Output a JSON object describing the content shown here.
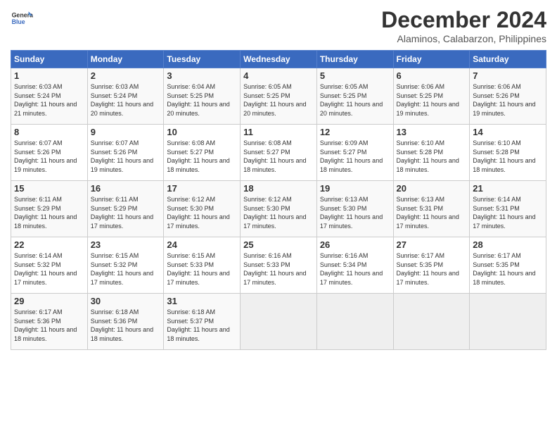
{
  "logo": {
    "line1": "General",
    "line2": "Blue"
  },
  "title": "December 2024",
  "location": "Alaminos, Calabarzon, Philippines",
  "days_of_week": [
    "Sunday",
    "Monday",
    "Tuesday",
    "Wednesday",
    "Thursday",
    "Friday",
    "Saturday"
  ],
  "weeks": [
    [
      {
        "day": "1",
        "sunrise": "Sunrise: 6:03 AM",
        "sunset": "Sunset: 5:24 PM",
        "daylight": "Daylight: 11 hours and 21 minutes."
      },
      {
        "day": "2",
        "sunrise": "Sunrise: 6:03 AM",
        "sunset": "Sunset: 5:24 PM",
        "daylight": "Daylight: 11 hours and 20 minutes."
      },
      {
        "day": "3",
        "sunrise": "Sunrise: 6:04 AM",
        "sunset": "Sunset: 5:25 PM",
        "daylight": "Daylight: 11 hours and 20 minutes."
      },
      {
        "day": "4",
        "sunrise": "Sunrise: 6:05 AM",
        "sunset": "Sunset: 5:25 PM",
        "daylight": "Daylight: 11 hours and 20 minutes."
      },
      {
        "day": "5",
        "sunrise": "Sunrise: 6:05 AM",
        "sunset": "Sunset: 5:25 PM",
        "daylight": "Daylight: 11 hours and 20 minutes."
      },
      {
        "day": "6",
        "sunrise": "Sunrise: 6:06 AM",
        "sunset": "Sunset: 5:25 PM",
        "daylight": "Daylight: 11 hours and 19 minutes."
      },
      {
        "day": "7",
        "sunrise": "Sunrise: 6:06 AM",
        "sunset": "Sunset: 5:26 PM",
        "daylight": "Daylight: 11 hours and 19 minutes."
      }
    ],
    [
      {
        "day": "8",
        "sunrise": "Sunrise: 6:07 AM",
        "sunset": "Sunset: 5:26 PM",
        "daylight": "Daylight: 11 hours and 19 minutes."
      },
      {
        "day": "9",
        "sunrise": "Sunrise: 6:07 AM",
        "sunset": "Sunset: 5:26 PM",
        "daylight": "Daylight: 11 hours and 19 minutes."
      },
      {
        "day": "10",
        "sunrise": "Sunrise: 6:08 AM",
        "sunset": "Sunset: 5:27 PM",
        "daylight": "Daylight: 11 hours and 18 minutes."
      },
      {
        "day": "11",
        "sunrise": "Sunrise: 6:08 AM",
        "sunset": "Sunset: 5:27 PM",
        "daylight": "Daylight: 11 hours and 18 minutes."
      },
      {
        "day": "12",
        "sunrise": "Sunrise: 6:09 AM",
        "sunset": "Sunset: 5:27 PM",
        "daylight": "Daylight: 11 hours and 18 minutes."
      },
      {
        "day": "13",
        "sunrise": "Sunrise: 6:10 AM",
        "sunset": "Sunset: 5:28 PM",
        "daylight": "Daylight: 11 hours and 18 minutes."
      },
      {
        "day": "14",
        "sunrise": "Sunrise: 6:10 AM",
        "sunset": "Sunset: 5:28 PM",
        "daylight": "Daylight: 11 hours and 18 minutes."
      }
    ],
    [
      {
        "day": "15",
        "sunrise": "Sunrise: 6:11 AM",
        "sunset": "Sunset: 5:29 PM",
        "daylight": "Daylight: 11 hours and 18 minutes."
      },
      {
        "day": "16",
        "sunrise": "Sunrise: 6:11 AM",
        "sunset": "Sunset: 5:29 PM",
        "daylight": "Daylight: 11 hours and 17 minutes."
      },
      {
        "day": "17",
        "sunrise": "Sunrise: 6:12 AM",
        "sunset": "Sunset: 5:30 PM",
        "daylight": "Daylight: 11 hours and 17 minutes."
      },
      {
        "day": "18",
        "sunrise": "Sunrise: 6:12 AM",
        "sunset": "Sunset: 5:30 PM",
        "daylight": "Daylight: 11 hours and 17 minutes."
      },
      {
        "day": "19",
        "sunrise": "Sunrise: 6:13 AM",
        "sunset": "Sunset: 5:30 PM",
        "daylight": "Daylight: 11 hours and 17 minutes."
      },
      {
        "day": "20",
        "sunrise": "Sunrise: 6:13 AM",
        "sunset": "Sunset: 5:31 PM",
        "daylight": "Daylight: 11 hours and 17 minutes."
      },
      {
        "day": "21",
        "sunrise": "Sunrise: 6:14 AM",
        "sunset": "Sunset: 5:31 PM",
        "daylight": "Daylight: 11 hours and 17 minutes."
      }
    ],
    [
      {
        "day": "22",
        "sunrise": "Sunrise: 6:14 AM",
        "sunset": "Sunset: 5:32 PM",
        "daylight": "Daylight: 11 hours and 17 minutes."
      },
      {
        "day": "23",
        "sunrise": "Sunrise: 6:15 AM",
        "sunset": "Sunset: 5:32 PM",
        "daylight": "Daylight: 11 hours and 17 minutes."
      },
      {
        "day": "24",
        "sunrise": "Sunrise: 6:15 AM",
        "sunset": "Sunset: 5:33 PM",
        "daylight": "Daylight: 11 hours and 17 minutes."
      },
      {
        "day": "25",
        "sunrise": "Sunrise: 6:16 AM",
        "sunset": "Sunset: 5:33 PM",
        "daylight": "Daylight: 11 hours and 17 minutes."
      },
      {
        "day": "26",
        "sunrise": "Sunrise: 6:16 AM",
        "sunset": "Sunset: 5:34 PM",
        "daylight": "Daylight: 11 hours and 17 minutes."
      },
      {
        "day": "27",
        "sunrise": "Sunrise: 6:17 AM",
        "sunset": "Sunset: 5:35 PM",
        "daylight": "Daylight: 11 hours and 17 minutes."
      },
      {
        "day": "28",
        "sunrise": "Sunrise: 6:17 AM",
        "sunset": "Sunset: 5:35 PM",
        "daylight": "Daylight: 11 hours and 18 minutes."
      }
    ],
    [
      {
        "day": "29",
        "sunrise": "Sunrise: 6:17 AM",
        "sunset": "Sunset: 5:36 PM",
        "daylight": "Daylight: 11 hours and 18 minutes."
      },
      {
        "day": "30",
        "sunrise": "Sunrise: 6:18 AM",
        "sunset": "Sunset: 5:36 PM",
        "daylight": "Daylight: 11 hours and 18 minutes."
      },
      {
        "day": "31",
        "sunrise": "Sunrise: 6:18 AM",
        "sunset": "Sunset: 5:37 PM",
        "daylight": "Daylight: 11 hours and 18 minutes."
      },
      null,
      null,
      null,
      null
    ]
  ]
}
